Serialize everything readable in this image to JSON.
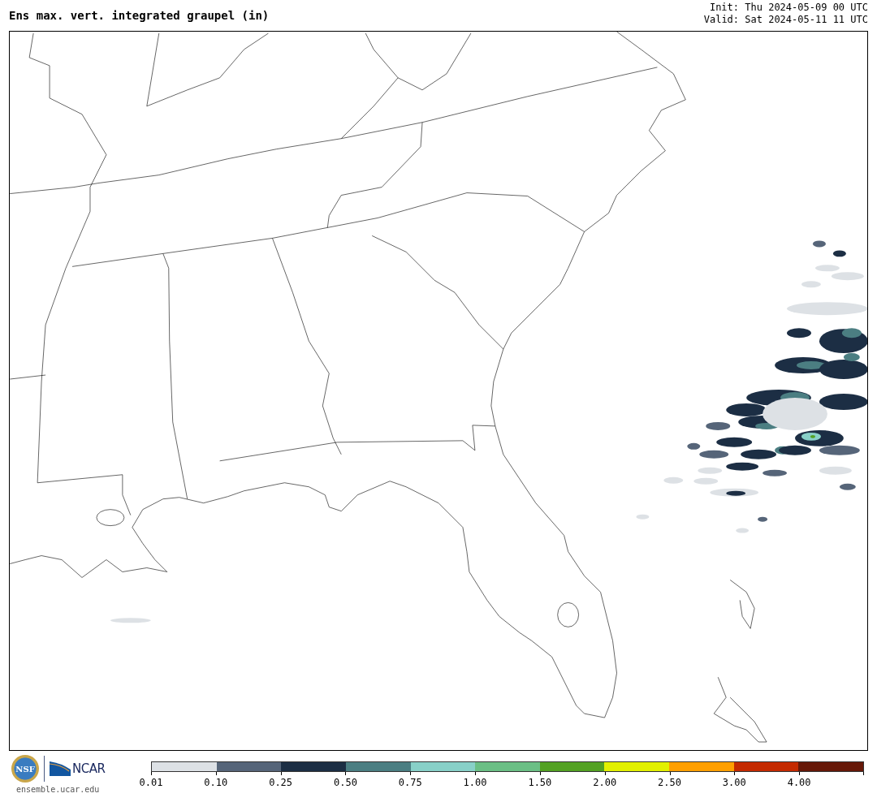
{
  "title": "Ens max. vert. integrated graupel (in)",
  "init": "Init: Thu 2024-05-09 00 UTC",
  "valid": "Valid: Sat 2024-05-11 11 UTC",
  "logos": {
    "nsf": "NSF",
    "ncar": "NCAR",
    "url": "ensemble.ucar.edu"
  },
  "colorbar": [
    {
      "label": "0.01",
      "color": "#dde1e5"
    },
    {
      "label": "0.10",
      "color": "#566579"
    },
    {
      "label": "0.25",
      "color": "#1c2e44"
    },
    {
      "label": "0.50",
      "color": "#4b7e82"
    },
    {
      "label": "0.75",
      "color": "#88d0c8"
    },
    {
      "label": "1.00",
      "color": "#6bbf85"
    },
    {
      "label": "1.50",
      "color": "#53a123"
    },
    {
      "label": "2.00",
      "color": "#e2f000"
    },
    {
      "label": "2.50",
      "color": "#ff9f00"
    },
    {
      "label": "3.00",
      "color": "#c42a00"
    },
    {
      "label": "4.00",
      "color": "#661808"
    }
  ]
}
